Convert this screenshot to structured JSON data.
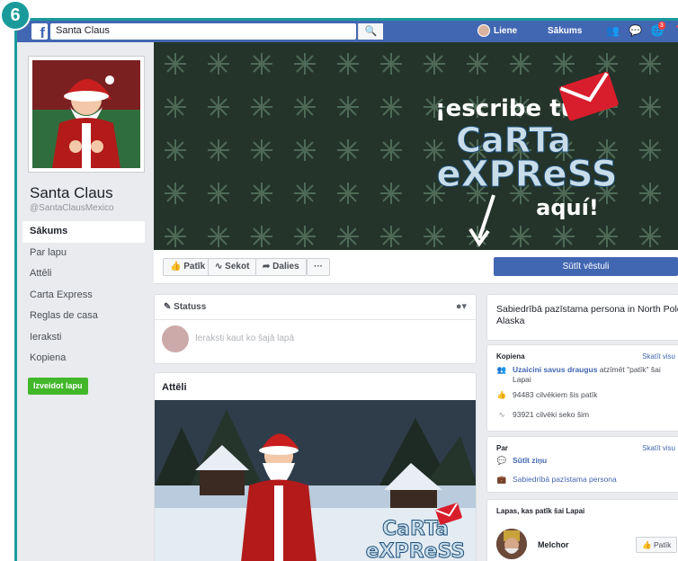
{
  "step_number": "6",
  "topbar": {
    "logo": "f",
    "search_value": "Santa Claus",
    "search_icon": "search-icon",
    "user_name": "Liene",
    "home_label": "Sākums",
    "icons": [
      "friends-icon",
      "messenger-icon",
      "globe-notifications-icon",
      "help-icon"
    ],
    "notification_count": "3",
    "bar_color": "#4267b2"
  },
  "profile": {
    "name": "Santa Claus",
    "handle": "@SantaClausMexico"
  },
  "nav": {
    "items": [
      {
        "label": "Sākums",
        "active": true
      },
      {
        "label": "Par lapu"
      },
      {
        "label": "Attēli"
      },
      {
        "label": "Carta Express"
      },
      {
        "label": "Reglas de casa"
      },
      {
        "label": "Ieraksti"
      },
      {
        "label": "Kopiena"
      }
    ],
    "create_page": "Izveidot lapu"
  },
  "cover": {
    "line1": "¡escribe tu",
    "line2": "CaRTa",
    "line3": "eXPReSS",
    "line4": "aquí!"
  },
  "actions": {
    "like": "Patīk",
    "follow": "Sekot",
    "share": "Dalies",
    "more": "···",
    "send_message": "Sūtīt vēstuli"
  },
  "status": {
    "title": "Statuss",
    "placeholder": "Ieraksti kaut ko šajā lapā"
  },
  "photos": {
    "title": "Attēli",
    "overlay_line1": "CaRTa",
    "overlay_line2": "eXPReSS"
  },
  "about": {
    "text": "Sabiedrībā pazīstama persona in North Pole, Alaska"
  },
  "community": {
    "title": "Kopiena",
    "see_all": "Skatīt visu",
    "invite_link": "Uzaicini savus draugus",
    "invite_rest": "atzīmēt \"patīk\" šai Lapai",
    "likes_text": "94483 cilvēkiem šis patīk",
    "follows_text": "93921 cilvēki seko šim"
  },
  "par": {
    "title": "Par",
    "see_all": "Skatīt visu",
    "message_link": "Sūtīt ziņu",
    "category_link": "Sabiedrībā pazīstama persona"
  },
  "liked_pages": {
    "title": "Lapas, kas patīk šai Lapai",
    "items": [
      {
        "name": "Melchor",
        "button": "Patīk"
      }
    ]
  },
  "colors": {
    "teal": "#1a9a9b",
    "fb_blue": "#4267b2",
    "green": "#42b72a",
    "page_bg": "#e9ebee"
  }
}
